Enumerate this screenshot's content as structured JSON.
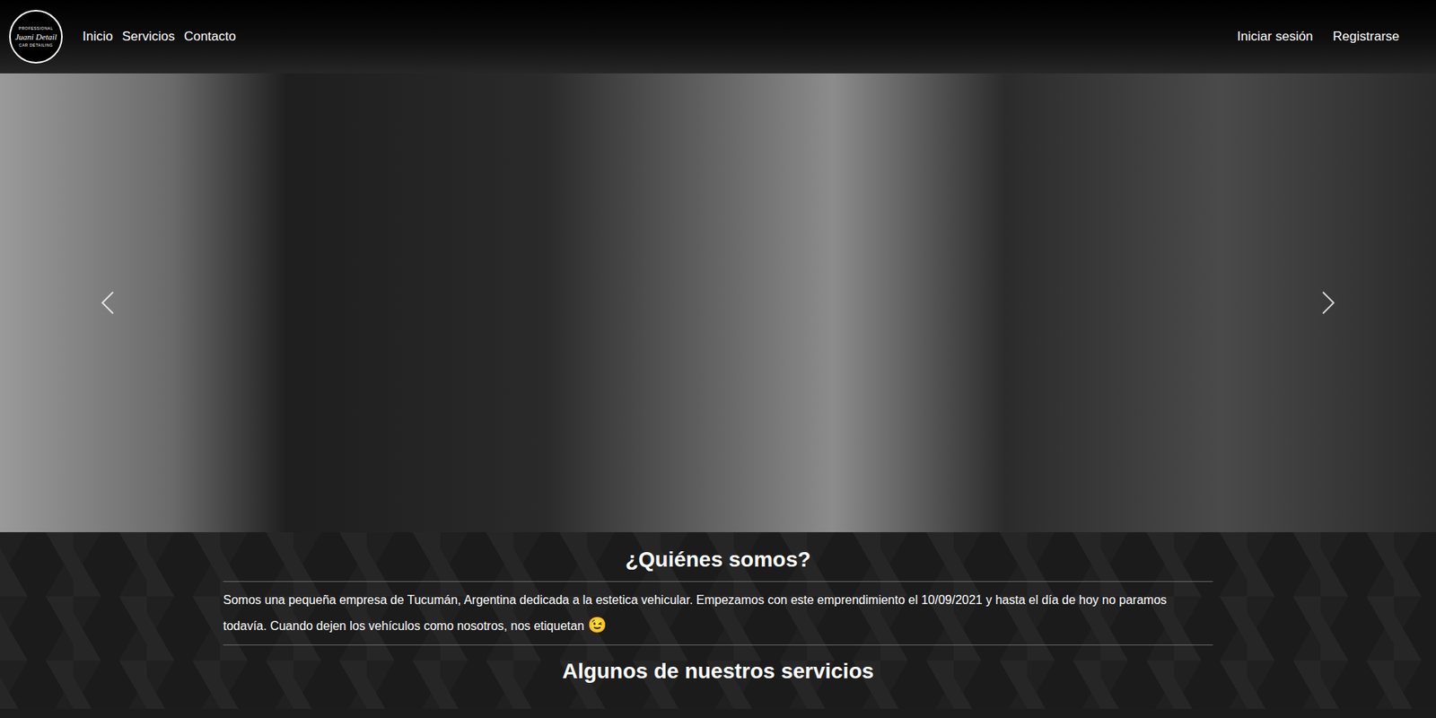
{
  "navbar": {
    "logo": {
      "top": "PROFESSIONAL",
      "name": "Juani Detail",
      "bottom": "CAR DETAILING"
    },
    "links": [
      {
        "label": "Inicio"
      },
      {
        "label": "Servicios"
      },
      {
        "label": "Contacto"
      }
    ],
    "auth": [
      {
        "label": "Iniciar sesión"
      },
      {
        "label": "Registrarse"
      }
    ]
  },
  "carousel": {
    "slide": "photo"
  },
  "about": {
    "title": "¿Quiénes somos?",
    "text": "Somos una pequeña empresa de Tucumán, Argentina dedicada a la estetica vehicular. Empezamos con este emprendimiento el 10/09/2021 y hasta el día de hoy no paramos todavía. Cuando dejen los vehículos como nosotros, nos etiquetan",
    "emoji": "😉"
  },
  "services": {
    "title": "Algunos de nuestros servicios"
  }
}
